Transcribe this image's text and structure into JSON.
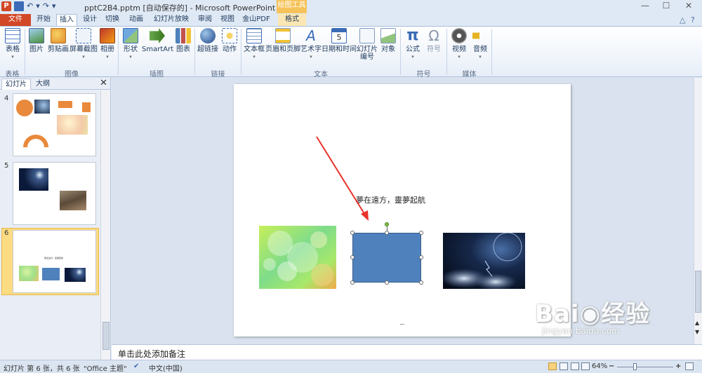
{
  "window": {
    "title": "pptC2B4.pptm [自动保存的] - Microsoft PowerPoint",
    "context_group": "绘图工具",
    "ppt_logo_letter": "P",
    "undo_glyph": "↶",
    "redo_glyph": "↷",
    "qat_dropdown": "▾",
    "min_glyph": "—",
    "max_glyph": "☐",
    "close_glyph": "✕"
  },
  "tabs": {
    "file": "文件",
    "items": [
      "开始",
      "插入",
      "设计",
      "切换",
      "动画",
      "幻灯片放映",
      "审阅",
      "视图",
      "金山PDF",
      "格式"
    ],
    "active": "插入",
    "collapse_glyph": "△",
    "help_glyph": "?"
  },
  "ribbon": {
    "buttons": [
      {
        "label": "表格",
        "icon": "table-icon"
      },
      {
        "label": "图片",
        "icon": "picture-icon"
      },
      {
        "label": "剪贴画",
        "icon": "clipart-icon"
      },
      {
        "label": "屏幕截图",
        "icon": "screenshot-icon"
      },
      {
        "label": "相册",
        "icon": "album-icon"
      },
      {
        "label": "形状",
        "icon": "shapes-icon"
      },
      {
        "label": "SmartArt",
        "icon": "smartart-icon"
      },
      {
        "label": "图表",
        "icon": "chart-icon"
      },
      {
        "label": "超链接",
        "icon": "hyperlink-icon"
      },
      {
        "label": "动作",
        "icon": "action-icon"
      },
      {
        "label": "文本框",
        "icon": "textbox-icon"
      },
      {
        "label": "页眉和页脚",
        "icon": "header-footer-icon"
      },
      {
        "label": "艺术字",
        "icon": "wordart-icon"
      },
      {
        "label": "日期和时间",
        "icon": "datetime-icon"
      },
      {
        "label": "幻灯片\n编号",
        "icon": "slide-number-icon"
      },
      {
        "label": "对象",
        "icon": "object-icon"
      },
      {
        "label": "公式",
        "icon": "equation-icon"
      },
      {
        "label": "符号",
        "icon": "symbol-icon"
      },
      {
        "label": "视频",
        "icon": "video-icon"
      },
      {
        "label": "音频",
        "icon": "audio-icon"
      }
    ],
    "groups": [
      "表格",
      "图像",
      "插图",
      "链接",
      "文本",
      "符号",
      "媒体"
    ],
    "dropdown_glyph": "▾",
    "equation_glyph": "π",
    "symbol_glyph": "Ω",
    "wordart_glyph": "A",
    "datetime_glyph": "5"
  },
  "leftpane": {
    "tabs": [
      "幻灯片",
      "大纲"
    ],
    "active_tab": "幻灯片",
    "close_glyph": "✕",
    "slides": [
      {
        "number": "4"
      },
      {
        "number": "5"
      },
      {
        "number": "6",
        "caption": "夢在遠方，靈夢起航"
      }
    ],
    "selected_slide": "6"
  },
  "slide": {
    "caption": "夢在遠方，靈夢起航"
  },
  "notes": {
    "placeholder": "单击此处添加备注"
  },
  "statusbar": {
    "slide_info": "幻灯片 第 6 张，共 6 张",
    "theme": "\"Office 主题\"",
    "language": "中文(中国)",
    "zoom": "64%",
    "zoom_minus": "−",
    "zoom_plus": "+"
  },
  "watermark": {
    "main": "Bai◉经验",
    "sub": "jingyan.baidu.com"
  },
  "colors": {
    "file_tab": "#d24726",
    "context_tab": "#f6c35b",
    "shape_fill": "#4f81bd",
    "selected_thumb": "#fcdc82",
    "arrow": "#e8322b"
  }
}
